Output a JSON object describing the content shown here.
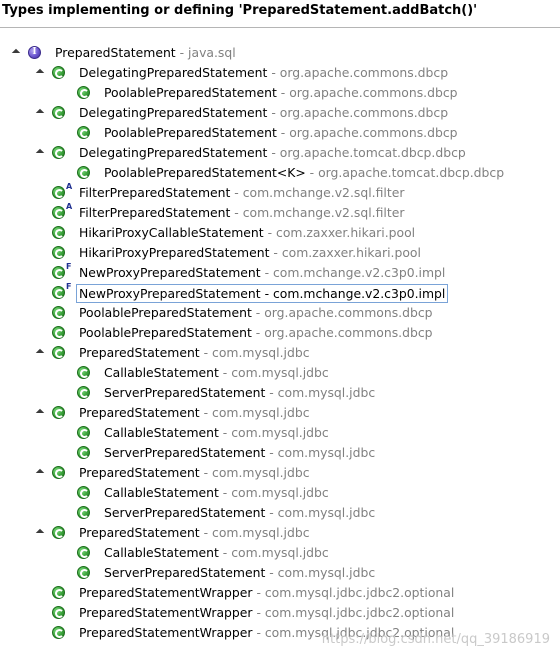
{
  "header": {
    "title": "Types implementing or defining 'PreparedStatement.addBatch()'"
  },
  "tree": [
    {
      "level": 0,
      "expanded": true,
      "kind": "interface",
      "modifier": "",
      "name": "PreparedStatement",
      "pkg": "java.sql"
    },
    {
      "level": 1,
      "expanded": true,
      "kind": "class",
      "modifier": "",
      "name": "DelegatingPreparedStatement",
      "pkg": "org.apache.commons.dbcp"
    },
    {
      "level": 2,
      "expanded": false,
      "kind": "class",
      "modifier": "",
      "name": "PoolablePreparedStatement",
      "pkg": "org.apache.commons.dbcp"
    },
    {
      "level": 1,
      "expanded": true,
      "kind": "class",
      "modifier": "",
      "name": "DelegatingPreparedStatement",
      "pkg": "org.apache.commons.dbcp"
    },
    {
      "level": 2,
      "expanded": false,
      "kind": "class",
      "modifier": "",
      "name": "PoolablePreparedStatement",
      "pkg": "org.apache.commons.dbcp"
    },
    {
      "level": 1,
      "expanded": true,
      "kind": "class",
      "modifier": "",
      "name": "DelegatingPreparedStatement",
      "pkg": "org.apache.tomcat.dbcp.dbcp"
    },
    {
      "level": 2,
      "expanded": false,
      "kind": "class",
      "modifier": "",
      "name": "PoolablePreparedStatement<K>",
      "pkg": "org.apache.tomcat.dbcp.dbcp"
    },
    {
      "level": 1,
      "expanded": false,
      "kind": "class",
      "modifier": "A",
      "name": "FilterPreparedStatement",
      "pkg": "com.mchange.v2.sql.filter"
    },
    {
      "level": 1,
      "expanded": false,
      "kind": "class",
      "modifier": "A",
      "name": "FilterPreparedStatement",
      "pkg": "com.mchange.v2.sql.filter"
    },
    {
      "level": 1,
      "expanded": false,
      "kind": "class",
      "modifier": "",
      "name": "HikariProxyCallableStatement",
      "pkg": "com.zaxxer.hikari.pool"
    },
    {
      "level": 1,
      "expanded": false,
      "kind": "class",
      "modifier": "",
      "name": "HikariProxyPreparedStatement",
      "pkg": "com.zaxxer.hikari.pool"
    },
    {
      "level": 1,
      "expanded": false,
      "kind": "class",
      "modifier": "F",
      "name": "NewProxyPreparedStatement",
      "pkg": "com.mchange.v2.c3p0.impl"
    },
    {
      "level": 1,
      "expanded": false,
      "kind": "class",
      "modifier": "F",
      "name": "NewProxyPreparedStatement",
      "pkg": "com.mchange.v2.c3p0.impl",
      "selected": true
    },
    {
      "level": 1,
      "expanded": false,
      "kind": "class",
      "modifier": "",
      "name": "PoolablePreparedStatement",
      "pkg": "org.apache.commons.dbcp"
    },
    {
      "level": 1,
      "expanded": false,
      "kind": "class",
      "modifier": "",
      "name": "PoolablePreparedStatement",
      "pkg": "org.apache.commons.dbcp"
    },
    {
      "level": 1,
      "expanded": true,
      "kind": "class",
      "modifier": "",
      "name": "PreparedStatement",
      "pkg": "com.mysql.jdbc"
    },
    {
      "level": 2,
      "expanded": false,
      "kind": "class",
      "modifier": "",
      "name": "CallableStatement",
      "pkg": "com.mysql.jdbc"
    },
    {
      "level": 2,
      "expanded": false,
      "kind": "class",
      "modifier": "",
      "name": "ServerPreparedStatement",
      "pkg": "com.mysql.jdbc"
    },
    {
      "level": 1,
      "expanded": true,
      "kind": "class",
      "modifier": "",
      "name": "PreparedStatement",
      "pkg": "com.mysql.jdbc"
    },
    {
      "level": 2,
      "expanded": false,
      "kind": "class",
      "modifier": "",
      "name": "CallableStatement",
      "pkg": "com.mysql.jdbc"
    },
    {
      "level": 2,
      "expanded": false,
      "kind": "class",
      "modifier": "",
      "name": "ServerPreparedStatement",
      "pkg": "com.mysql.jdbc"
    },
    {
      "level": 1,
      "expanded": true,
      "kind": "class",
      "modifier": "",
      "name": "PreparedStatement",
      "pkg": "com.mysql.jdbc"
    },
    {
      "level": 2,
      "expanded": false,
      "kind": "class",
      "modifier": "",
      "name": "CallableStatement",
      "pkg": "com.mysql.jdbc"
    },
    {
      "level": 2,
      "expanded": false,
      "kind": "class",
      "modifier": "",
      "name": "ServerPreparedStatement",
      "pkg": "com.mysql.jdbc"
    },
    {
      "level": 1,
      "expanded": true,
      "kind": "class",
      "modifier": "",
      "name": "PreparedStatement",
      "pkg": "com.mysql.jdbc"
    },
    {
      "level": 2,
      "expanded": false,
      "kind": "class",
      "modifier": "",
      "name": "CallableStatement",
      "pkg": "com.mysql.jdbc"
    },
    {
      "level": 2,
      "expanded": false,
      "kind": "class",
      "modifier": "",
      "name": "ServerPreparedStatement",
      "pkg": "com.mysql.jdbc"
    },
    {
      "level": 1,
      "expanded": false,
      "kind": "class",
      "modifier": "",
      "name": "PreparedStatementWrapper",
      "pkg": "com.mysql.jdbc.jdbc2.optional"
    },
    {
      "level": 1,
      "expanded": false,
      "kind": "class",
      "modifier": "",
      "name": "PreparedStatementWrapper",
      "pkg": "com.mysql.jdbc.jdbc2.optional"
    },
    {
      "level": 1,
      "expanded": false,
      "kind": "class",
      "modifier": "",
      "name": "PreparedStatementWrapper",
      "pkg": "com.mysql.jdbc.jdbc2.optional"
    }
  ],
  "watermark": "https://blog.csdn.net/qq_39186919"
}
